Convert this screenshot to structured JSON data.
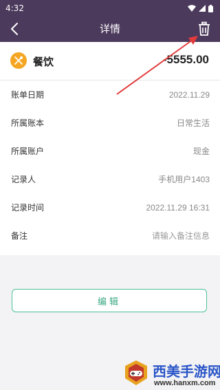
{
  "status_bar": {
    "time": "4:32",
    "icons": [
      "wifi-icon",
      "signal-icon",
      "battery-icon"
    ]
  },
  "nav": {
    "title": "详情",
    "back_icon": "chevron-left-icon",
    "delete_icon": "trash-icon"
  },
  "record": {
    "category": "餐饮",
    "category_icon": "fork-knife-icon",
    "amount": "-5555.00"
  },
  "details": [
    {
      "label": "账单日期",
      "value": "2022.11.29"
    },
    {
      "label": "所属账本",
      "value": "日常生活"
    },
    {
      "label": "所属账户",
      "value": "现金"
    },
    {
      "label": "记录人",
      "value": "手机用户1403"
    },
    {
      "label": "记录时间",
      "value": "2022.11.29 16:31"
    }
  ],
  "note": {
    "label": "备注",
    "placeholder": "请输入备注信息"
  },
  "edit_button": {
    "label": "编辑"
  },
  "watermark": {
    "title": "西美手游网",
    "url": "www.hanxm.com"
  },
  "colors": {
    "header_bg": "#4b3a5c",
    "category_icon_bg": "#f5a623",
    "edit_accent": "#4bbf98",
    "annotation_arrow": "#e23b3b"
  }
}
